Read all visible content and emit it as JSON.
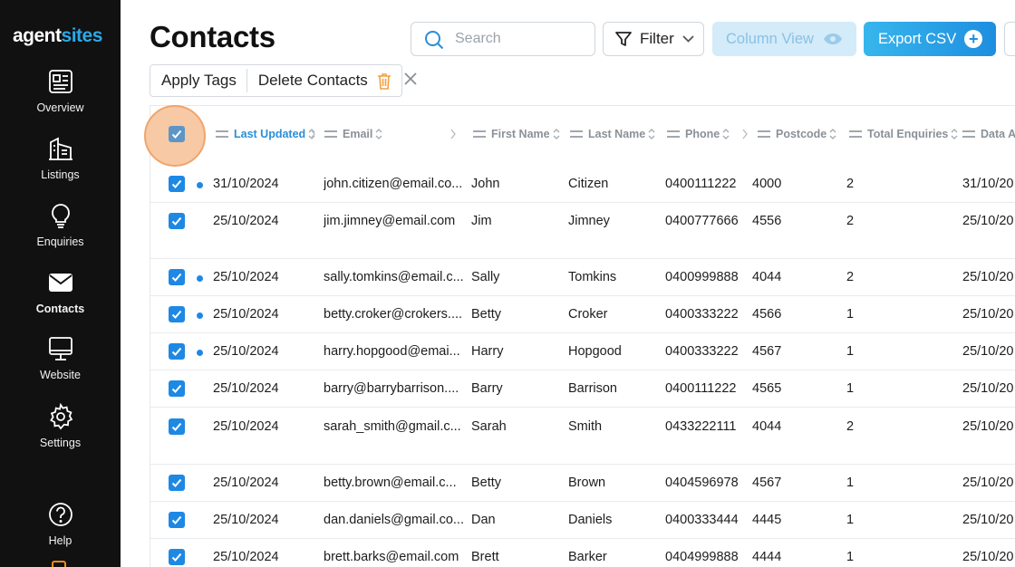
{
  "brand": {
    "part1": "agent",
    "part2": "sites"
  },
  "sidebar": {
    "items": [
      {
        "label": "Overview",
        "icon": "overview-icon",
        "active": false
      },
      {
        "label": "Listings",
        "icon": "listings-icon",
        "active": false
      },
      {
        "label": "Enquiries",
        "icon": "enquiries-icon",
        "active": false
      },
      {
        "label": "Contacts",
        "icon": "contacts-icon",
        "active": true
      },
      {
        "label": "Website",
        "icon": "website-icon",
        "active": false
      },
      {
        "label": "Settings",
        "icon": "settings-icon",
        "active": false
      },
      {
        "label": "Help",
        "icon": "help-icon",
        "active": false
      }
    ]
  },
  "page": {
    "title": "Contacts"
  },
  "toolbar": {
    "search_placeholder": "Search",
    "filter_label": "Filter",
    "column_view_label": "Column View",
    "export_label": "Export CSV"
  },
  "bulk_actions": {
    "apply_tags": "Apply Tags",
    "delete_contacts": "Delete Contacts"
  },
  "colors": {
    "accent": "#1e88e5",
    "brand": "#29a9e8",
    "sidebar_bg": "#111111",
    "highlight_ring": "#f8c9a5"
  },
  "table": {
    "columns": [
      "Last Updated",
      "Email",
      "First Name",
      "Last Name",
      "Phone",
      "Postcode",
      "Total Enquiries",
      "Data A"
    ],
    "rows": [
      {
        "unread": true,
        "last_updated": "31/10/2024",
        "email": "john.citizen@email.co...",
        "first": "John",
        "last": "Citizen",
        "phone": "0400111222",
        "postcode": "4000",
        "enquiries": "2",
        "date_added": "31/10/20"
      },
      {
        "unread": false,
        "last_updated": "25/10/2024",
        "email": "jim.jimney@email.com",
        "first": "Jim",
        "last": "Jimney",
        "phone": "0400777666",
        "postcode": "4556",
        "enquiries": "2",
        "date_added": "25/10/20"
      },
      {
        "unread": true,
        "last_updated": "25/10/2024",
        "email": "sally.tomkins@email.c...",
        "first": "Sally",
        "last": "Tomkins",
        "phone": "0400999888",
        "postcode": "4044",
        "enquiries": "2",
        "date_added": "25/10/20"
      },
      {
        "unread": true,
        "last_updated": "25/10/2024",
        "email": "betty.croker@crokers....",
        "first": "Betty",
        "last": "Croker",
        "phone": "0400333222",
        "postcode": "4566",
        "enquiries": "1",
        "date_added": "25/10/20"
      },
      {
        "unread": true,
        "last_updated": "25/10/2024",
        "email": "harry.hopgood@emai...",
        "first": "Harry",
        "last": "Hopgood",
        "phone": "0400333222",
        "postcode": "4567",
        "enquiries": "1",
        "date_added": "25/10/20"
      },
      {
        "unread": false,
        "last_updated": "25/10/2024",
        "email": "barry@barrybarrison....",
        "first": "Barry",
        "last": "Barrison",
        "phone": "0400111222",
        "postcode": "4565",
        "enquiries": "1",
        "date_added": "25/10/20"
      },
      {
        "unread": false,
        "last_updated": "25/10/2024",
        "email": "sarah_smith@gmail.c...",
        "first": "Sarah",
        "last": "Smith",
        "phone": "0433222111",
        "postcode": "4044",
        "enquiries": "2",
        "date_added": "25/10/20"
      },
      {
        "unread": false,
        "last_updated": "25/10/2024",
        "email": "betty.brown@email.c...",
        "first": "Betty",
        "last": "Brown",
        "phone": "0404596978",
        "postcode": "4567",
        "enquiries": "1",
        "date_added": "25/10/20"
      },
      {
        "unread": false,
        "last_updated": "25/10/2024",
        "email": "dan.daniels@gmail.co...",
        "first": "Dan",
        "last": "Daniels",
        "phone": "0400333444",
        "postcode": "4445",
        "enquiries": "1",
        "date_added": "25/10/20"
      },
      {
        "unread": false,
        "last_updated": "25/10/2024",
        "email": "brett.barks@email.com",
        "first": "Brett",
        "last": "Barker",
        "phone": "0404999888",
        "postcode": "4444",
        "enquiries": "1",
        "date_added": "25/10/20"
      }
    ]
  }
}
